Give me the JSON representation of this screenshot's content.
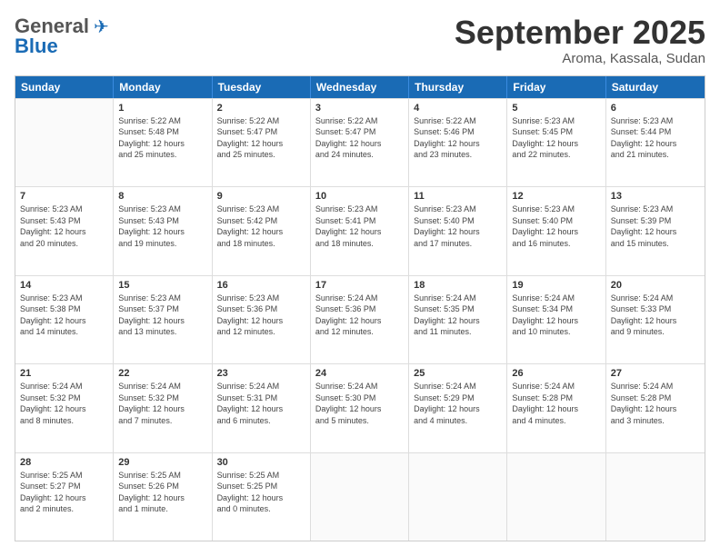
{
  "logo": {
    "general": "General",
    "blue": "Blue"
  },
  "title": "September 2025",
  "location": "Aroma, Kassala, Sudan",
  "headers": [
    "Sunday",
    "Monday",
    "Tuesday",
    "Wednesday",
    "Thursday",
    "Friday",
    "Saturday"
  ],
  "weeks": [
    [
      {
        "day": "",
        "info": ""
      },
      {
        "day": "1",
        "info": "Sunrise: 5:22 AM\nSunset: 5:48 PM\nDaylight: 12 hours\nand 25 minutes."
      },
      {
        "day": "2",
        "info": "Sunrise: 5:22 AM\nSunset: 5:47 PM\nDaylight: 12 hours\nand 25 minutes."
      },
      {
        "day": "3",
        "info": "Sunrise: 5:22 AM\nSunset: 5:47 PM\nDaylight: 12 hours\nand 24 minutes."
      },
      {
        "day": "4",
        "info": "Sunrise: 5:22 AM\nSunset: 5:46 PM\nDaylight: 12 hours\nand 23 minutes."
      },
      {
        "day": "5",
        "info": "Sunrise: 5:23 AM\nSunset: 5:45 PM\nDaylight: 12 hours\nand 22 minutes."
      },
      {
        "day": "6",
        "info": "Sunrise: 5:23 AM\nSunset: 5:44 PM\nDaylight: 12 hours\nand 21 minutes."
      }
    ],
    [
      {
        "day": "7",
        "info": "Sunrise: 5:23 AM\nSunset: 5:43 PM\nDaylight: 12 hours\nand 20 minutes."
      },
      {
        "day": "8",
        "info": "Sunrise: 5:23 AM\nSunset: 5:43 PM\nDaylight: 12 hours\nand 19 minutes."
      },
      {
        "day": "9",
        "info": "Sunrise: 5:23 AM\nSunset: 5:42 PM\nDaylight: 12 hours\nand 18 minutes."
      },
      {
        "day": "10",
        "info": "Sunrise: 5:23 AM\nSunset: 5:41 PM\nDaylight: 12 hours\nand 18 minutes."
      },
      {
        "day": "11",
        "info": "Sunrise: 5:23 AM\nSunset: 5:40 PM\nDaylight: 12 hours\nand 17 minutes."
      },
      {
        "day": "12",
        "info": "Sunrise: 5:23 AM\nSunset: 5:40 PM\nDaylight: 12 hours\nand 16 minutes."
      },
      {
        "day": "13",
        "info": "Sunrise: 5:23 AM\nSunset: 5:39 PM\nDaylight: 12 hours\nand 15 minutes."
      }
    ],
    [
      {
        "day": "14",
        "info": "Sunrise: 5:23 AM\nSunset: 5:38 PM\nDaylight: 12 hours\nand 14 minutes."
      },
      {
        "day": "15",
        "info": "Sunrise: 5:23 AM\nSunset: 5:37 PM\nDaylight: 12 hours\nand 13 minutes."
      },
      {
        "day": "16",
        "info": "Sunrise: 5:23 AM\nSunset: 5:36 PM\nDaylight: 12 hours\nand 12 minutes."
      },
      {
        "day": "17",
        "info": "Sunrise: 5:24 AM\nSunset: 5:36 PM\nDaylight: 12 hours\nand 12 minutes."
      },
      {
        "day": "18",
        "info": "Sunrise: 5:24 AM\nSunset: 5:35 PM\nDaylight: 12 hours\nand 11 minutes."
      },
      {
        "day": "19",
        "info": "Sunrise: 5:24 AM\nSunset: 5:34 PM\nDaylight: 12 hours\nand 10 minutes."
      },
      {
        "day": "20",
        "info": "Sunrise: 5:24 AM\nSunset: 5:33 PM\nDaylight: 12 hours\nand 9 minutes."
      }
    ],
    [
      {
        "day": "21",
        "info": "Sunrise: 5:24 AM\nSunset: 5:32 PM\nDaylight: 12 hours\nand 8 minutes."
      },
      {
        "day": "22",
        "info": "Sunrise: 5:24 AM\nSunset: 5:32 PM\nDaylight: 12 hours\nand 7 minutes."
      },
      {
        "day": "23",
        "info": "Sunrise: 5:24 AM\nSunset: 5:31 PM\nDaylight: 12 hours\nand 6 minutes."
      },
      {
        "day": "24",
        "info": "Sunrise: 5:24 AM\nSunset: 5:30 PM\nDaylight: 12 hours\nand 5 minutes."
      },
      {
        "day": "25",
        "info": "Sunrise: 5:24 AM\nSunset: 5:29 PM\nDaylight: 12 hours\nand 4 minutes."
      },
      {
        "day": "26",
        "info": "Sunrise: 5:24 AM\nSunset: 5:28 PM\nDaylight: 12 hours\nand 4 minutes."
      },
      {
        "day": "27",
        "info": "Sunrise: 5:24 AM\nSunset: 5:28 PM\nDaylight: 12 hours\nand 3 minutes."
      }
    ],
    [
      {
        "day": "28",
        "info": "Sunrise: 5:25 AM\nSunset: 5:27 PM\nDaylight: 12 hours\nand 2 minutes."
      },
      {
        "day": "29",
        "info": "Sunrise: 5:25 AM\nSunset: 5:26 PM\nDaylight: 12 hours\nand 1 minute."
      },
      {
        "day": "30",
        "info": "Sunrise: 5:25 AM\nSunset: 5:25 PM\nDaylight: 12 hours\nand 0 minutes."
      },
      {
        "day": "",
        "info": ""
      },
      {
        "day": "",
        "info": ""
      },
      {
        "day": "",
        "info": ""
      },
      {
        "day": "",
        "info": ""
      }
    ]
  ]
}
